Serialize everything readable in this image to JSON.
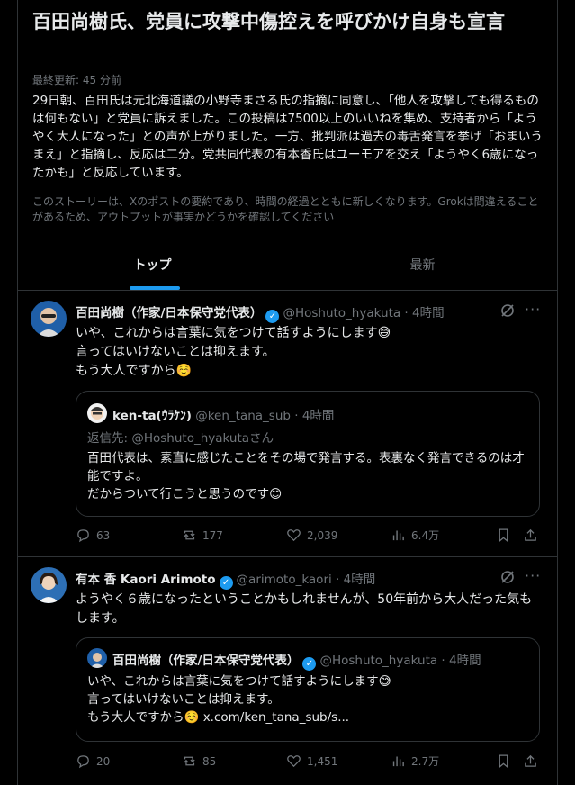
{
  "story": {
    "headline": "百田尚樹氏、党員に攻撃中傷控えを呼びかけ自身も宣言",
    "updated": "最終更新: 45 分前",
    "summary": "29日朝、百田氏は元北海道議の小野寺まさる氏の指摘に同意し、「他人を攻撃しても得るものは何もない」と党員に訴えました。この投稿は7500以上のいいねを集め、支持者から「ようやく大人になった」との声が上がりました。一方、批判派は過去の毒舌発言を挙げ「おまいうまえ」と指摘し、反応は二分。党共同代表の有本香氏はユーモアを交え「ようやく6歳になったかも」と反応しています。",
    "disclaimer": "このストーリーは、Xのポストの要約であり、時間の経過とともに新しくなります。Grokは間違えることがあるため、アウトプットが事実かどうかを確認してください"
  },
  "tabs": {
    "top": "トップ",
    "latest": "最新"
  },
  "posts": [
    {
      "name": "百田尚樹（作家/日本保守党代表）",
      "handle": "@Hoshuto_hyakuta · 4時間",
      "text": "いや、これからは言葉に気をつけて話すようにします😅\n言ってはいけないことは抑えます。\nもう大人ですから☺️",
      "quote": {
        "name": "ken-ta(ｳﾗｹﾝ)",
        "handle": "@ken_tana_sub · 4時間",
        "reply": "返信先: @Hoshuto_hyakutaさん",
        "text": "百田代表は、素直に感じたことをその場で発言する。表裏なく発言できるのは才能ですよ。\nだからついて行こうと思うのです😊"
      },
      "replies": "63",
      "reposts": "177",
      "likes": "2,039",
      "views": "6.4万"
    },
    {
      "name": "有本 香 Kaori Arimoto",
      "handle": "@arimoto_kaori · 4時間",
      "text": "ようやく６歳になったということかもしれませんが、50年前から大人だった気もします。",
      "quote": {
        "name": "百田尚樹（作家/日本保守党代表）",
        "handle": "@Hoshuto_hyakuta · 4時間",
        "text": "いや、これからは言葉に気をつけて話すようにします😅\n言ってはいけないことは抑えます。\nもう大人ですから☺️ x.com/ken_tana_sub/s..."
      },
      "replies": "20",
      "reposts": "85",
      "likes": "1,451",
      "views": "2.7万"
    }
  ],
  "colors": {
    "accent": "#1d9bf0",
    "muted": "#71767b",
    "border": "#2f3336"
  }
}
